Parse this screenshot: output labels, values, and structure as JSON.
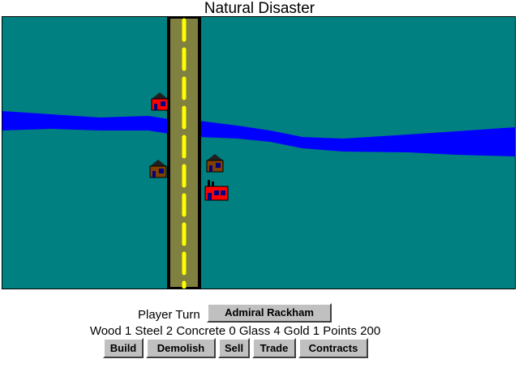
{
  "title": "Natural Disaster",
  "colors": {
    "land": "#008080",
    "river": "#0000ff",
    "road": "#808040",
    "road_edge": "#000000",
    "road_line": "#ffff00",
    "building_red": "#ff0000",
    "building_brown": "#804000",
    "window": "#000080"
  },
  "map": {
    "buildings": [
      {
        "name": "red-house-icon",
        "color": "building_red"
      },
      {
        "name": "brown-house-icon",
        "color": "building_brown"
      },
      {
        "name": "brown-house-icon",
        "color": "building_brown"
      },
      {
        "name": "red-factory-icon",
        "color": "building_red"
      }
    ]
  },
  "turn": {
    "label": "Player Turn",
    "player": "Admiral Rackham"
  },
  "resources": {
    "wood_label": "Wood",
    "wood": "1",
    "steel_label": "Steel",
    "steel": "2",
    "concrete_label": "Concrete",
    "concrete": "0",
    "glass_label": "Glass",
    "glass": "4",
    "gold_label": "Gold",
    "gold": "1",
    "points_label": "Points",
    "points": "200"
  },
  "actions": {
    "build": "Build",
    "demolish": "Demolish",
    "sell": "Sell",
    "trade": "Trade",
    "contracts": "Contracts"
  }
}
